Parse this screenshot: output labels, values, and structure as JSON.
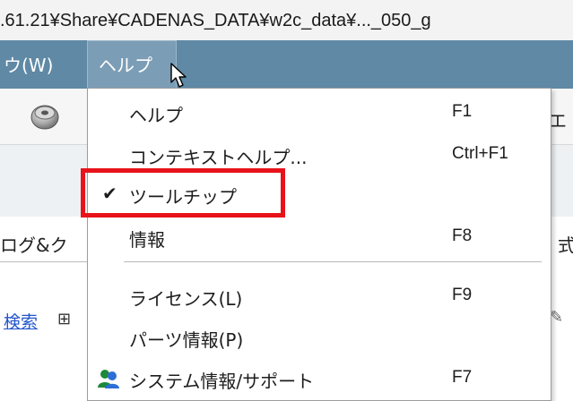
{
  "titlebar": {
    "path": ".61.21¥Share¥CADENAS_DATA¥w2c_data¥..._050_g"
  },
  "menubar": {
    "window_label": "ウ(W)",
    "help_label": "ヘルプ"
  },
  "toolbar": {
    "right_glyph": "エ"
  },
  "background": {
    "log_label": "ログ&ク",
    "log_right": "式",
    "search_link": "検索"
  },
  "menu": {
    "items": [
      {
        "label": "ヘルプ",
        "shortcut": "F1"
      },
      {
        "label": "コンテキストヘルプ...",
        "shortcut": "Ctrl+F1"
      },
      {
        "label": "ツールチップ",
        "shortcut": "",
        "checked": true
      },
      {
        "label": "情報",
        "shortcut": "F8"
      },
      {
        "label": "ライセンス(L)",
        "shortcut": "F9"
      },
      {
        "label": "パーツ情報(P)",
        "shortcut": ""
      },
      {
        "label": "システム情報/サポート",
        "shortcut": "F7"
      }
    ],
    "check_glyph": "✔"
  },
  "colors": {
    "menubar": "#5f89a5",
    "menubar_active": "#7c9db6",
    "highlight_border": "#e8131a"
  },
  "icons": [
    "gear-icon",
    "cursor-icon",
    "check-icon",
    "system-support-icon"
  ]
}
